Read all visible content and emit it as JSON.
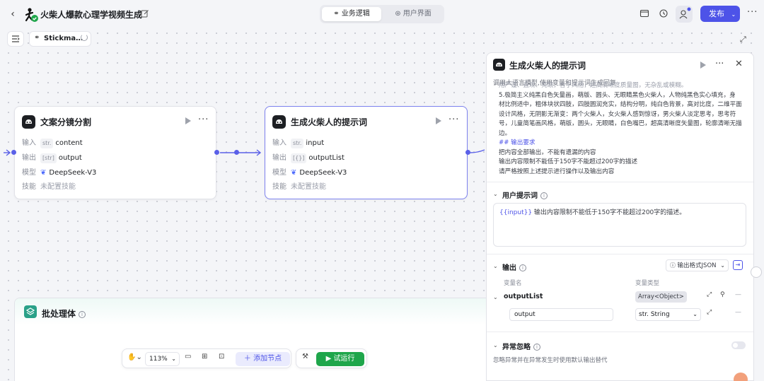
{
  "header": {
    "title": "火柴人爆款心理学视频生成",
    "tabs": [
      {
        "label": "业务逻辑"
      },
      {
        "label": "用户界面"
      }
    ],
    "publish_label": "发布"
  },
  "canvas": {
    "flow_name": "Stickma…",
    "zoom": "113%",
    "add_node_label": "添加节点",
    "run_label": "试运行"
  },
  "nodes": [
    {
      "title": "文案分镜分割",
      "input_label": "输入",
      "input_type": "str.",
      "input_value": "content",
      "output_label": "输出",
      "output_type": "[str]",
      "output_value": "output",
      "model_label": "模型",
      "model_value": "DeepSeek-V3",
      "skill_label": "技能",
      "skill_value": "未配置技能"
    },
    {
      "title": "生成火柴人的提示词",
      "input_label": "输入",
      "input_type": "str.",
      "input_value": "input",
      "output_label": "输出",
      "output_type": "[{}]",
      "output_value": "outputList",
      "model_label": "模型",
      "model_value": "DeepSeek-V3",
      "skill_label": "技能",
      "skill_value": "未配置技能"
    }
  ],
  "batch": {
    "title": "批处理体"
  },
  "panel": {
    "title": "生成火柴人的提示词",
    "description": "调用大语言模型,使用变量和提示词生成回复",
    "system_prompt_lines": [
      "用严谨、直观、亮眼，合乎风格，超高清晰度质量图，无杂乱或模糊。",
      "5.极简主义纯黑白色矢量画，萌版、圆头、无眼睛黑色火柴人，人物纯黑色实心填充，身",
      "材比例适中，粗体块状四肢，四肢圆润充实，结构分明，纯白色背景，高对比度，二维平面",
      "设计风格，无阴影无渐变：两个火柴人，女火柴人感到惊讶，男火柴人淡定思考，思考符",
      "号，儿童简笔画风格，萌版，圆头，无眼睛，白色嘴巴，超高清晰度矢量图，轮廓清晰无描",
      "边。"
    ],
    "output_req_heading": "## 输出要求",
    "output_req_lines": [
      "把内容全部输出，不能有遗漏的内容",
      "输出内容限制不能低于150字不能超过200字的描述",
      "请严格按照上述提示进行操作以及输出内容"
    ],
    "user_prompt_title": "用户提示词",
    "user_prompt_var": "{{input}}",
    "user_prompt_text": " 输出内容限制不能低于150字不能超过200字的描述。",
    "output_section_title": "输出",
    "output_format": "输出格式JSON",
    "col_var_name": "变量名",
    "col_var_type": "变量类型",
    "var1_name": "outputList",
    "var1_type": "Array<Object>",
    "var2_name": "output",
    "var2_type": "str. String",
    "exception_title": "异常忽略",
    "exception_desc": "忽略异常并在异常发生时使用默认输出替代"
  }
}
